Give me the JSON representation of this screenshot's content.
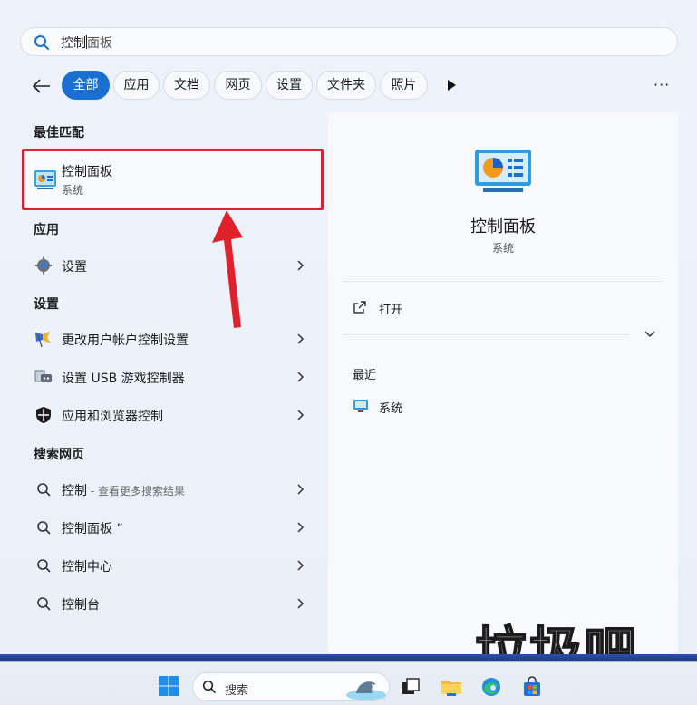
{
  "search": {
    "query_typed": "控制",
    "query_suggest": "面板"
  },
  "filters": [
    "全部",
    "应用",
    "文档",
    "网页",
    "设置",
    "文件夹",
    "照片"
  ],
  "more_label": "···",
  "sections": {
    "best": "最佳匹配",
    "apps": "应用",
    "settings": "设置",
    "web": "搜索网页"
  },
  "best_match": {
    "title": "控制面板",
    "subtitle": "系统"
  },
  "apps": [
    {
      "label": "设置"
    }
  ],
  "settings": [
    {
      "label": "更改用户帐户控制设置"
    },
    {
      "label": "设置 USB 游戏控制器"
    },
    {
      "label": "应用和浏览器控制"
    }
  ],
  "web": [
    {
      "label": "控制",
      "sub": " - 查看更多搜索结果"
    },
    {
      "label": "控制面板 ”",
      "sub": ""
    },
    {
      "label": "控制中心",
      "sub": ""
    },
    {
      "label": "控制台",
      "sub": ""
    }
  ],
  "preview": {
    "title": "控制面板",
    "type": "系统",
    "open": "打开",
    "recent": "最近",
    "recent_item": "系统"
  },
  "watermark": "垃圾吧",
  "taskbar": {
    "search_placeholder": "搜索"
  },
  "colors": {
    "accent": "#1a6fd1",
    "highlight_border": "#e0202b",
    "arrow": "#e0202b"
  }
}
